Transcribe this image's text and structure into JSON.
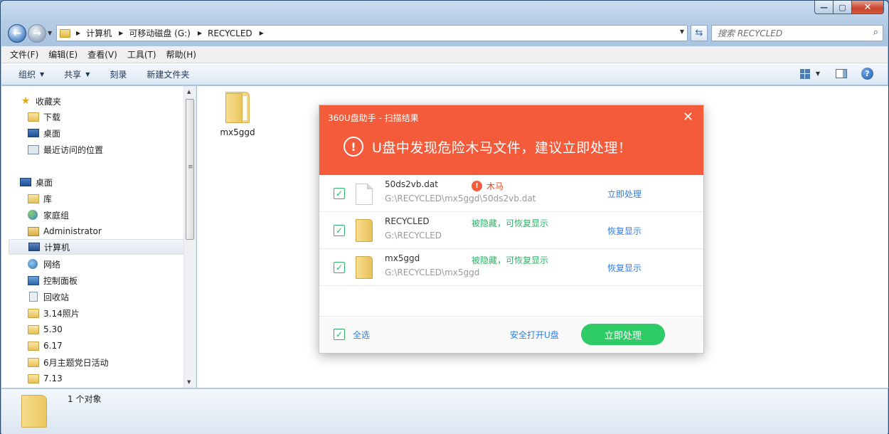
{
  "window": {
    "address": [
      "计算机",
      "可移动磁盘 (G:)",
      "RECYCLED"
    ],
    "search_placeholder": "搜索 RECYCLED",
    "caption": {
      "minimize": "—",
      "maximize": "▢",
      "close": "✕"
    }
  },
  "menubar": [
    "文件(F)",
    "编辑(E)",
    "查看(V)",
    "工具(T)",
    "帮助(H)"
  ],
  "commandbar": {
    "organize": "组织",
    "share": "共享",
    "burn": "刻录",
    "new_folder": "新建文件夹"
  },
  "navpane": {
    "favorites": "收藏夹",
    "fav_items": [
      "下载",
      "桌面",
      "最近访问的位置"
    ],
    "desktop": "桌面",
    "desktop_items": [
      "库",
      "家庭组",
      "Administrator",
      "计算机",
      "网络",
      "控制面板",
      "回收站",
      "3.14照片",
      "5.30",
      "6.17",
      "6月主题党日活动",
      "7.13"
    ]
  },
  "content": {
    "files": [
      {
        "name": "mx5ggd"
      }
    ]
  },
  "details": {
    "count_text": "1 个对象"
  },
  "dialog": {
    "title": "360U盘助手 - 扫描结果",
    "headline": "U盘中发现危险木马文件，建议立即处理！",
    "rows": [
      {
        "name": "50ds2vb.dat",
        "path": "G:\\RECYCLED\\mx5ggd\\50ds2vb.dat",
        "status": "木马",
        "action": "立即处理"
      },
      {
        "name": "RECYCLED",
        "path": "G:\\RECYCLED",
        "status": "被隐藏，可恢复显示",
        "action": "恢复显示"
      },
      {
        "name": "mx5ggd",
        "path": "G:\\RECYCLED\\mx5ggd",
        "status": "被隐藏，可恢复显示",
        "action": "恢复显示"
      }
    ],
    "select_all": "全选",
    "safe_open": "安全打开U盘",
    "primary_button": "立即处理",
    "colors": {
      "header": "#f35b3a",
      "green": "#2ecb66",
      "link": "#2f7de1"
    }
  }
}
